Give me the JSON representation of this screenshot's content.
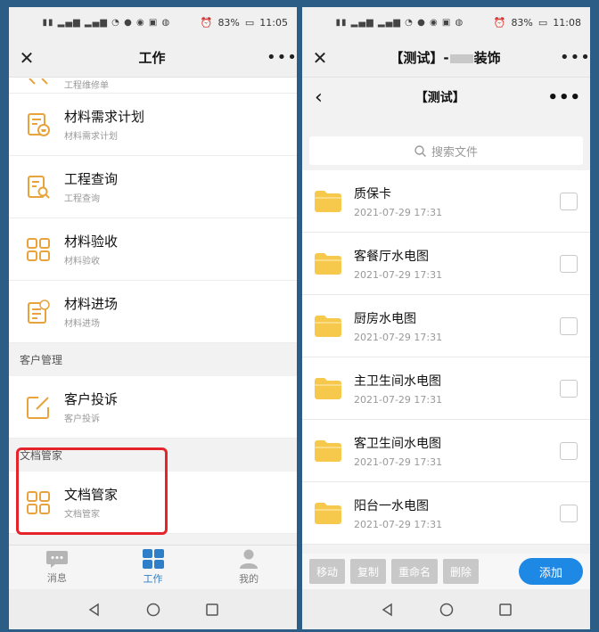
{
  "left": {
    "status_time": "11:05",
    "status_battery": "83%",
    "title": "工作",
    "partial_item_sub": "工程维修单",
    "items_a": [
      {
        "title": "材料需求计划",
        "sub": "材料需求计划",
        "icon": "material-plan-icon"
      },
      {
        "title": "工程查询",
        "sub": "工程查询",
        "icon": "project-query-icon"
      },
      {
        "title": "材料验收",
        "sub": "材料验收",
        "icon": "grid-icon"
      },
      {
        "title": "材料进场",
        "sub": "材料进场",
        "icon": "material-entry-icon"
      }
    ],
    "section_customer": "客户管理",
    "customer_item": {
      "title": "客户投诉",
      "sub": "客户投诉",
      "icon": "edit-icon"
    },
    "section_docs": "文档管家",
    "docs_item": {
      "title": "文档管家",
      "sub": "文档管家",
      "icon": "grid-icon"
    },
    "tabs": [
      {
        "label": "消息",
        "icon": "message-icon"
      },
      {
        "label": "工作",
        "icon": "work-grid-icon"
      },
      {
        "label": "我的",
        "icon": "user-icon"
      }
    ],
    "accent": "#e8a33c",
    "highlight": "#e5232a"
  },
  "right": {
    "status_time": "11:08",
    "status_battery": "83%",
    "title": "【测试】-",
    "title_suffix": "装饰",
    "page_title": "【测试】",
    "search_placeholder": "搜索文件",
    "files": [
      {
        "name": "质保卡",
        "date": "2021-07-29 17:31"
      },
      {
        "name": "客餐厅水电图",
        "date": "2021-07-29 17:31"
      },
      {
        "name": "厨房水电图",
        "date": "2021-07-29 17:31"
      },
      {
        "name": "主卫生间水电图",
        "date": "2021-07-29 17:31"
      },
      {
        "name": "客卫生间水电图",
        "date": "2021-07-29 17:31"
      },
      {
        "name": "阳台一水电图",
        "date": "2021-07-29 17:31"
      }
    ],
    "actions": {
      "move": "移动",
      "copy": "复制",
      "rename": "重命名",
      "delete": "删除",
      "add": "添加"
    },
    "folder_color": "#f6c94c",
    "add_color": "#1e88e5"
  }
}
